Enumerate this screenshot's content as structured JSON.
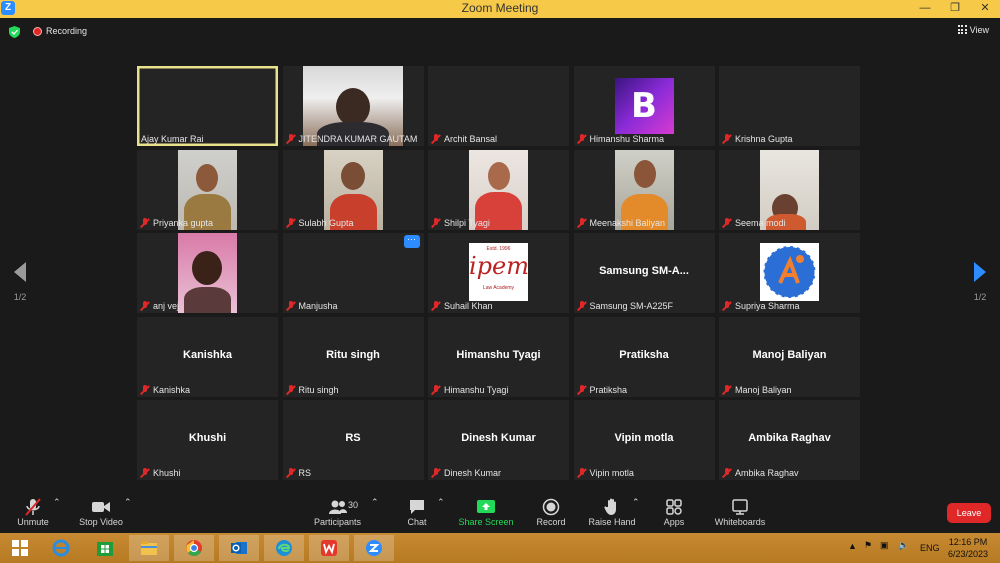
{
  "window": {
    "title": "Zoom Meeting",
    "logo_letter": "Z"
  },
  "topbar": {
    "recording_label": "Recording",
    "view_label": "View"
  },
  "pagination": {
    "left_page": "1/2",
    "right_page": "1/2"
  },
  "participants_tiles": [
    {
      "label": "Ajay Kumar Rai",
      "muted": false,
      "active": true,
      "type": "blank"
    },
    {
      "label": "JITENDRA KUMAR GAUTAM",
      "muted": true,
      "type": "video"
    },
    {
      "label": "Archit Bansal",
      "muted": true,
      "type": "blank"
    },
    {
      "label": "Himanshu Sharma",
      "muted": true,
      "type": "avatar-b"
    },
    {
      "label": "Krishna Gupta",
      "muted": true,
      "type": "blank"
    },
    {
      "label": "Priyanka gupta",
      "muted": true,
      "type": "video"
    },
    {
      "label": "Sulabh Gupta",
      "muted": true,
      "type": "video"
    },
    {
      "label": "Shilpi Tyagi",
      "muted": true,
      "type": "video"
    },
    {
      "label": "Meenakshi Baliyan",
      "muted": true,
      "type": "video"
    },
    {
      "label": "Seema modi",
      "muted": true,
      "type": "video"
    },
    {
      "label": "anj vej",
      "muted": true,
      "type": "video"
    },
    {
      "label": "Manjusha",
      "muted": true,
      "type": "blank",
      "more": "···"
    },
    {
      "label": "Suhail Khan",
      "muted": true,
      "type": "logo-ipem"
    },
    {
      "label": "Samsung SM-A225F",
      "muted": true,
      "type": "name",
      "big": "Samsung  SM-A..."
    },
    {
      "label": "Supriya Sharma",
      "muted": true,
      "type": "logo-circle"
    },
    {
      "label": "Kanishka",
      "muted": true,
      "type": "name",
      "big": "Kanishka"
    },
    {
      "label": "Ritu singh",
      "muted": true,
      "type": "name",
      "big": "Ritu singh"
    },
    {
      "label": "Himanshu Tyagi",
      "muted": true,
      "type": "name",
      "big": "Himanshu Tyagi"
    },
    {
      "label": "Pratiksha",
      "muted": true,
      "type": "name",
      "big": "Pratiksha"
    },
    {
      "label": "Manoj Baliyan",
      "muted": true,
      "type": "name",
      "big": "Manoj Baliyan"
    },
    {
      "label": "Khushi",
      "muted": true,
      "type": "name",
      "big": "Khushi"
    },
    {
      "label": "RS",
      "muted": true,
      "type": "name",
      "big": "RS"
    },
    {
      "label": "Dinesh Kumar",
      "muted": true,
      "type": "name",
      "big": "Dinesh Kumar"
    },
    {
      "label": "Vipin motla",
      "muted": true,
      "type": "name",
      "big": "Vipin motla"
    },
    {
      "label": "Ambika Raghav",
      "muted": true,
      "type": "name",
      "big": "Ambika Raghav"
    }
  ],
  "ipem_logo": {
    "estd": "Estd. 1996",
    "name": "ipem",
    "sub": "Law Academy"
  },
  "avatar_letter": "B",
  "toolbar": {
    "unmute": "Unmute",
    "stop_video": "Stop Video",
    "participants": "Participants",
    "participants_count": "30",
    "chat": "Chat",
    "share_screen": "Share Screen",
    "record": "Record",
    "raise_hand": "Raise Hand",
    "apps": "Apps",
    "whiteboards": "Whiteboards",
    "leave": "Leave"
  },
  "colors": {
    "accent": "#2d8cff",
    "share": "#23d959",
    "leave": "#e02828",
    "active_border": "#e8e28a",
    "tile_bg": "#242424"
  },
  "taskbar": {
    "apps": [
      "windows-start-icon",
      "ie-icon",
      "store-icon",
      "file-explorer-icon",
      "chrome-icon",
      "outlook-icon",
      "edge-icon",
      "office-icon",
      "zoom-icon"
    ],
    "lang": "ENG",
    "time": "12:16 PM",
    "date": "6/23/2023"
  }
}
